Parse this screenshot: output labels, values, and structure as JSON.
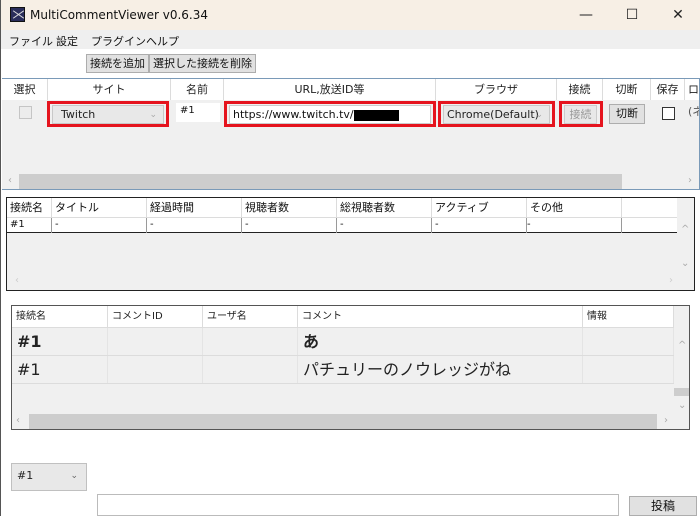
{
  "window": {
    "title": "MultiCommentViewer v0.6.34",
    "controls": {
      "minimize": "—",
      "maximize": "☐",
      "close": "✕"
    }
  },
  "menu": [
    "ファイル",
    "設定",
    "プラグイン",
    "ヘルプ"
  ],
  "toolbar": {
    "add_connection": "接続を追加",
    "delete_selected": "選択した接続を削除"
  },
  "connections": {
    "headers": [
      "選択",
      "サイト",
      "名前",
      "URL,放送ID等",
      "ブラウザ",
      "接続",
      "切断",
      "保存",
      "ロ"
    ],
    "rows": [
      {
        "selected": false,
        "site": "Twitch",
        "name": "#1",
        "url": "https://www.twitch.tv/",
        "url_redacted": true,
        "browser": "Chrome(Default)",
        "connect_label": "接続",
        "disconnect_label": "切断",
        "save": false,
        "extra": "(ネ"
      }
    ]
  },
  "metadata": {
    "headers": [
      "接続名",
      "タイトル",
      "経過時間",
      "視聴者数",
      "総視聴者数",
      "アクティブ",
      "その他"
    ],
    "rows": [
      [
        "#1",
        "-",
        "-",
        "-",
        "-",
        "-",
        "-"
      ]
    ]
  },
  "comments": {
    "headers": [
      "接続名",
      "コメントID",
      "ユーザ名",
      "コメント",
      "情報"
    ],
    "rows": [
      {
        "connection": "#1",
        "comment_id": "",
        "user": "",
        "comment": "あ",
        "info": "",
        "bold": true
      },
      {
        "connection": "#1",
        "comment_id": "",
        "user": "",
        "comment": "パチュリーのノウレッジがね",
        "info": "",
        "bold": false
      }
    ]
  },
  "footer": {
    "connection_select": "#1",
    "comment_input_value": "",
    "post_label": "投稿"
  },
  "icons": {
    "dropdown": "⌄",
    "scroll_left": "‹",
    "scroll_right": "›",
    "scroll_up": "^",
    "scroll_down": "⌄"
  },
  "colors": {
    "highlight_box": "#e5141e",
    "titlebar": "#f7efe5"
  }
}
